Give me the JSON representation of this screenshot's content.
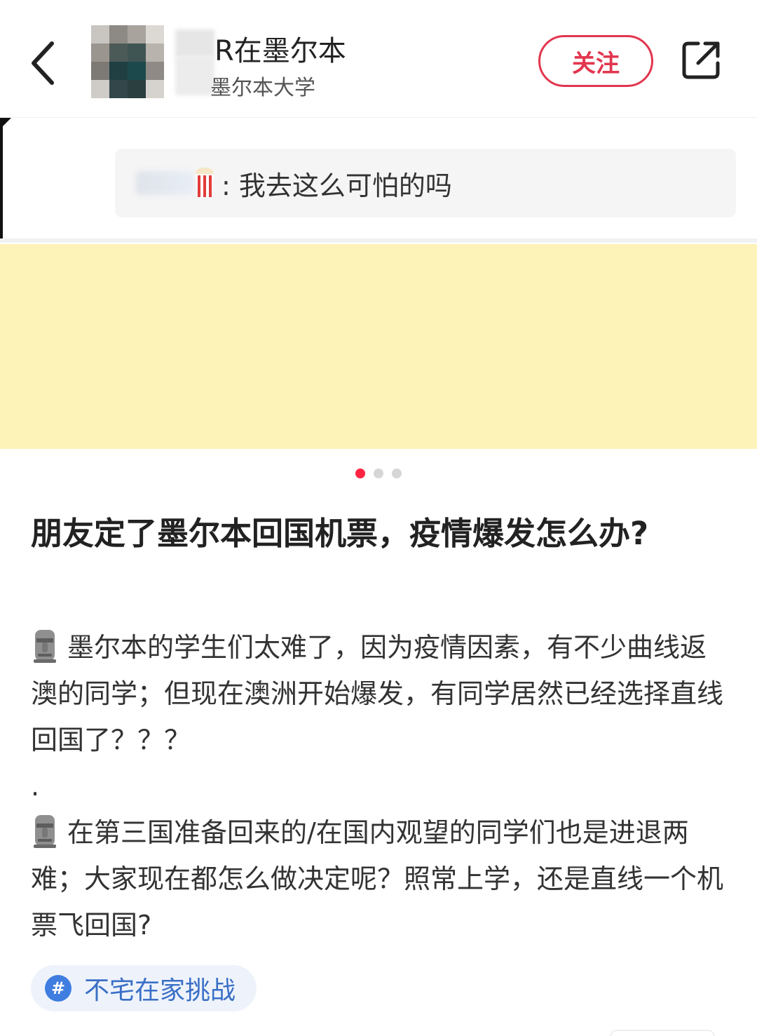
{
  "header": {
    "user_name": "R在墨尔本",
    "user_school": "墨尔本大学",
    "follow_label": "关注",
    "back_icon": "chevron-left-icon",
    "share_icon": "share-icon"
  },
  "slide": {
    "comment_text": ": 我去这么可怕的吗",
    "comment_icon": "popcorn-icon",
    "highlight_color": "#fdf2b8",
    "page_count": 3,
    "active_page": 1
  },
  "post": {
    "title": "朋友定了墨尔本回国机票，疫情爆发怎么办?",
    "paragraph_1": "墨尔本的学生们太难了，因为疫情因素，有不少曲线返澳的同学；但现在澳洲开始爆发，有同学居然已经选择直线回国了？？？",
    "separator": ".",
    "paragraph_2": "在第三国准备回来的/在国内观望的同学们也是进退两难；大家现在都怎么做决定呢？照常上学，还是直线一个机票飞回国?",
    "paragraph_icon": "moai-icon"
  },
  "tag": {
    "label": "不宅在家挑战",
    "icon_glyph": "#"
  },
  "colors": {
    "accent": "#ff2442",
    "follow": "#e2364f",
    "tag_text": "#3a6fc6",
    "tag_bg": "#eef3fb"
  }
}
